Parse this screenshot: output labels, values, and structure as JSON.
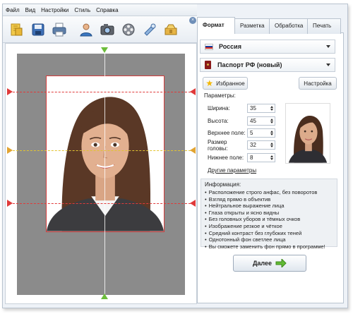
{
  "menu": [
    "Файл",
    "Вид",
    "Настройки",
    "Стиль",
    "Справка"
  ],
  "toolbar": {
    "buttons": [
      "open-icon",
      "save-icon",
      "print-icon",
      "person-icon",
      "camera-icon",
      "film-icon",
      "settings-icon",
      "wrench-icon"
    ],
    "close_glyph": "×"
  },
  "tabs": [
    {
      "label": "Формат",
      "active": true
    },
    {
      "label": "Разметка",
      "active": false
    },
    {
      "label": "Обработка",
      "active": false
    },
    {
      "label": "Печать",
      "active": false
    }
  ],
  "country": "Россия",
  "document_type": "Паспорт РФ (новый)",
  "favorites_label": "Избранное",
  "settings_label": "Настройка",
  "params": {
    "title": "Параметры:",
    "rows": [
      {
        "label": "Ширина:",
        "value": "35"
      },
      {
        "label": "Высота:",
        "value": "45"
      },
      {
        "label": "Верхнее поле:",
        "value": "5"
      },
      {
        "label": "Размер головы:",
        "value": "32"
      },
      {
        "label": "Нижнее поле:",
        "value": "8"
      }
    ],
    "more_link": "Другие параметры"
  },
  "info": {
    "title": "Информация:",
    "items": [
      "Расположение строго анфас, без поворотов",
      "Взгляд прямо в объектив",
      "Нейтральное выражение лица",
      "Глаза открыты и ясно видны",
      "Без головных уборов и тёмных очков",
      "Изображение резкое и чёткое",
      "Средний контраст без глубоких теней",
      "Однотонный фон светлее лица",
      "Вы сможете заменить фон прямо в программе!"
    ]
  },
  "next_label": "Далее",
  "colors": {
    "guide_red": "#e03a3a",
    "guide_yellow": "#e2c431",
    "marker_green": "#6cbd3b",
    "flag": [
      "#ffffff",
      "#1c3f9e",
      "#d52b1e"
    ]
  }
}
